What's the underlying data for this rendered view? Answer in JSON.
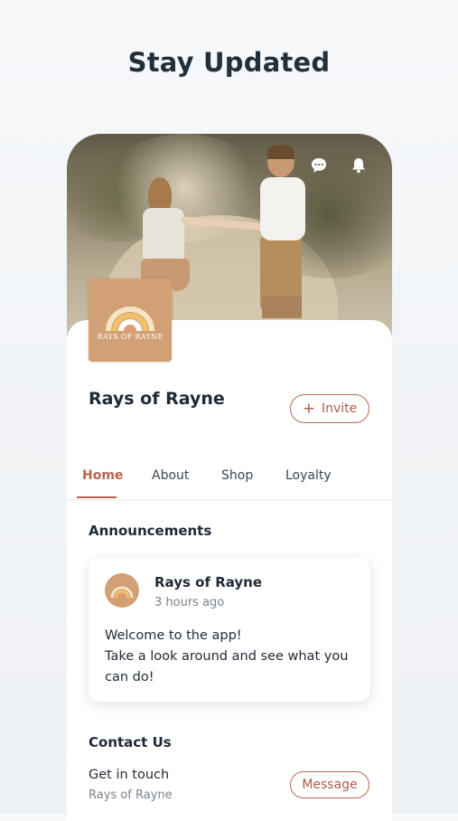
{
  "headline": "Stay Updated",
  "colors": {
    "accent": "#b8634d",
    "brand_tile": "#d1a075"
  },
  "header_icons": [
    "chat-bubble-icon",
    "bell-icon"
  ],
  "business": {
    "name": "Rays of Rayne",
    "logo_text": "RAYS OF RAYNE",
    "invite_label": "Invite"
  },
  "tabs": [
    {
      "label": "Home",
      "active": true
    },
    {
      "label": "About"
    },
    {
      "label": "Shop"
    },
    {
      "label": "Loyalty"
    }
  ],
  "announcements": {
    "title": "Announcements",
    "post": {
      "author": "Rays of Rayne",
      "time": "3 hours ago",
      "line1": "Welcome to the app!",
      "line2": "Take a look around and see what you can do!"
    }
  },
  "contact": {
    "title": "Contact Us",
    "label": "Get in touch",
    "sub": "Rays of Rayne",
    "message_label": "Message"
  }
}
